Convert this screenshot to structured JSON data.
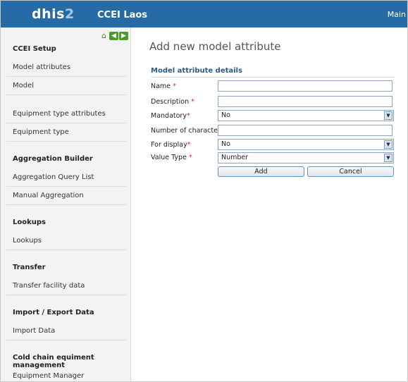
{
  "header": {
    "logo_main": "dhis",
    "logo_num": "2",
    "instance": "CCEI Laos",
    "menu": "Main"
  },
  "sidebar": {
    "sections": [
      {
        "title": "CCEI Setup",
        "items": [
          "Model attributes",
          "Model",
          "Equipment type attributes",
          "Equipment type"
        ]
      },
      {
        "title": "Aggregation Builder",
        "items": [
          "Aggregation Query List",
          "Manual Aggregation"
        ]
      },
      {
        "title": "Lookups",
        "items": [
          "Lookups"
        ]
      },
      {
        "title": "Transfer",
        "items": [
          "Transfer facility data"
        ]
      },
      {
        "title": "Import / Export Data",
        "items": [
          "Import Data"
        ]
      },
      {
        "title": "Cold chain equiment management",
        "items": [
          "Equipment Manager"
        ]
      }
    ]
  },
  "page": {
    "title": "Add new model attribute",
    "section": "Model attribute details"
  },
  "form": {
    "name_label": "Name",
    "description_label": "Description",
    "mandatory_label": "Mandatory",
    "numchars_label": "Number of characters",
    "display_label": "For display",
    "valuetype_label": "Value Type",
    "req_mark": "*",
    "name_value": "",
    "description_value": "",
    "numchars_value": "",
    "mandatory_value": "No",
    "display_value": "No",
    "valuetype_value": "Number",
    "add_label": "Add",
    "cancel_label": "Cancel"
  },
  "icons": {
    "home": "home-icon",
    "back": "arrow-left-icon",
    "forward": "arrow-right-icon",
    "dropdown": "chevron-down-icon"
  },
  "colors": {
    "header_bg": "#266aa6",
    "section_title": "#2c5a88",
    "required": "#cc2a2a"
  }
}
